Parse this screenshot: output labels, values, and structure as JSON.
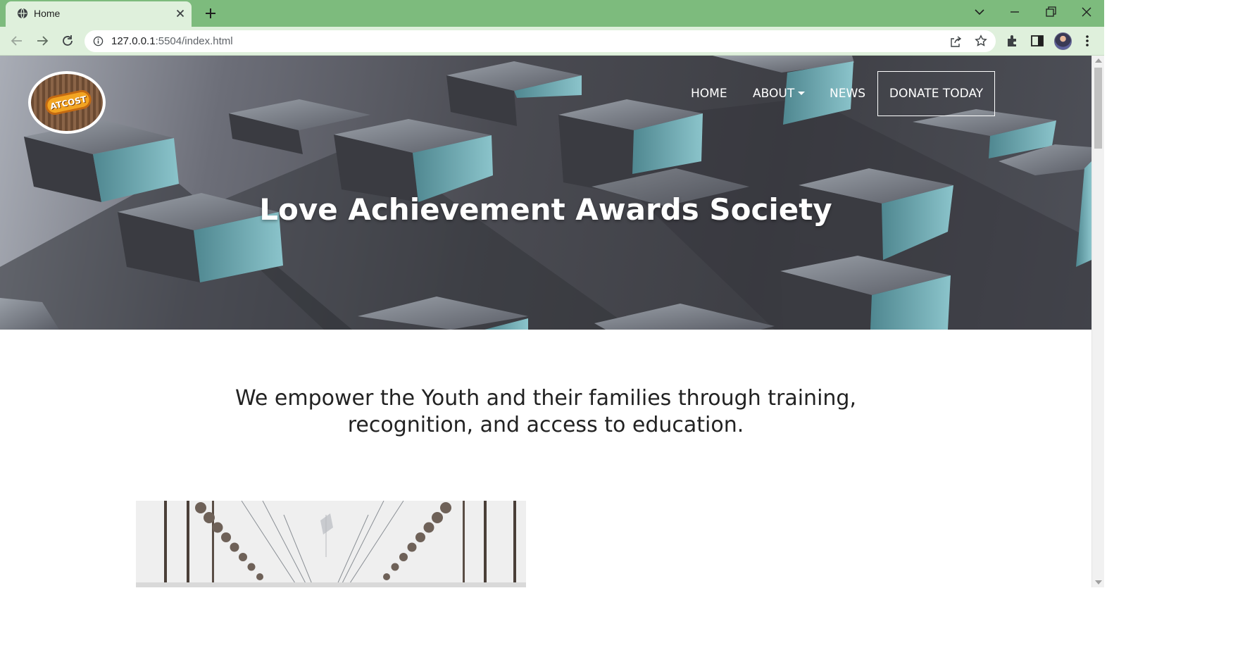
{
  "browser": {
    "tab_title": "Home",
    "url_host": "127.0.0.1",
    "url_rest": ":5504/index.html"
  },
  "nav": {
    "home": "HOME",
    "about": "ABOUT",
    "news": "NEWS",
    "donate": "DONATE TODAY"
  },
  "logo": {
    "text": "ATCOST"
  },
  "hero": {
    "title": "Love Achievement Awards Society"
  },
  "mission": {
    "text": "We empower the Youth and their families through training, recognition, and access to education."
  },
  "colors": {
    "tabbar": "#7dbb7d",
    "toolbar": "#dff0dc",
    "hero_dark": "#3e3f45",
    "accent_teal": "#5e9aa2"
  }
}
